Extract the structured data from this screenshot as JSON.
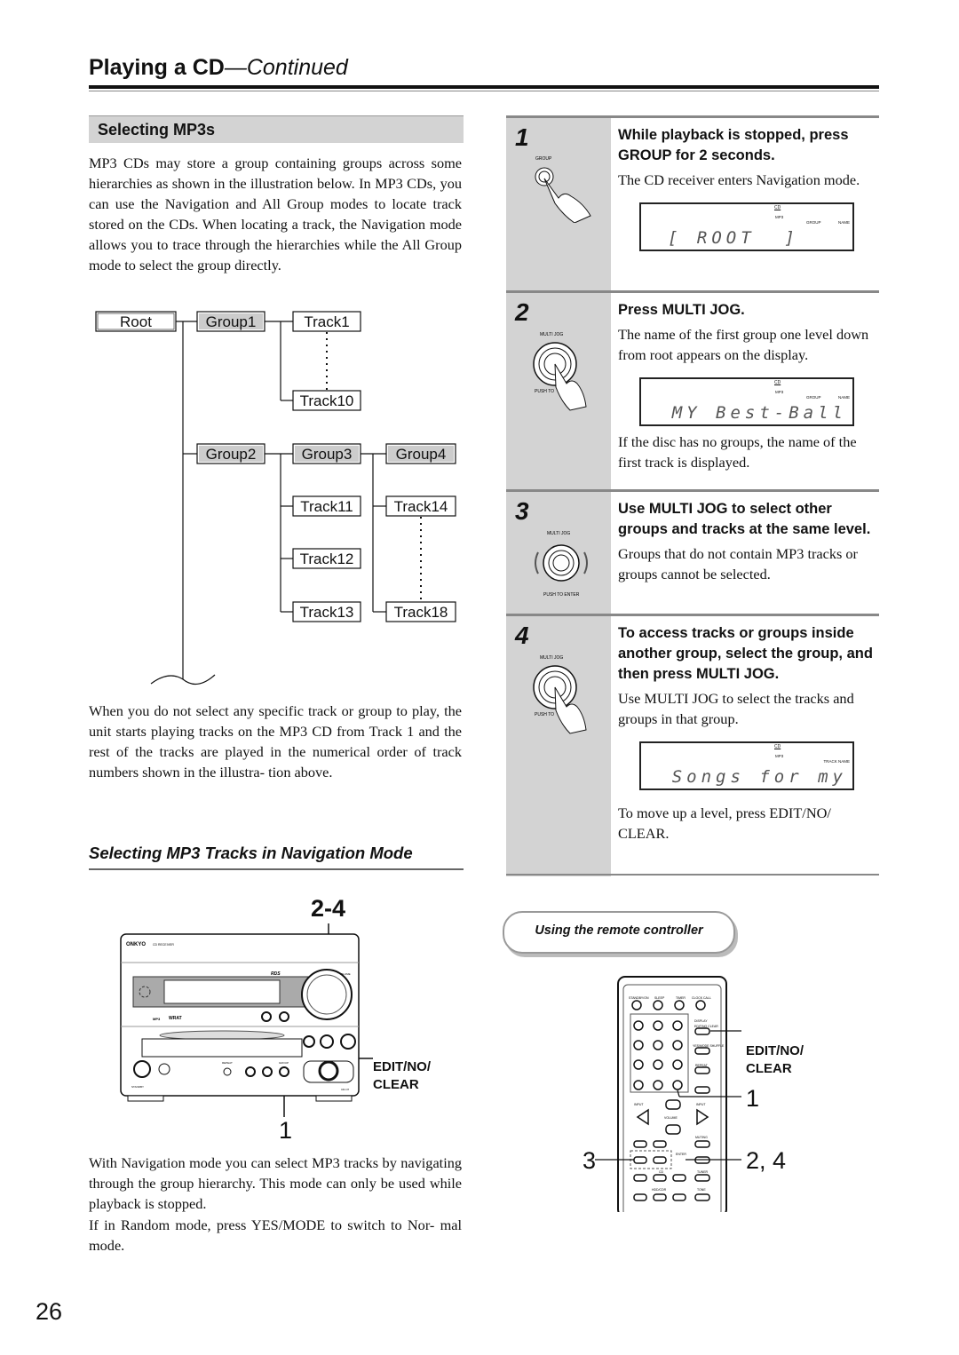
{
  "header": {
    "title": "Playing a CD",
    "title_suffix": "—Continued"
  },
  "section1": {
    "heading": "Selecting MP3s",
    "intro": "MP3 CDs may store a group containing groups across some hierarchies as shown in the illustration below. In MP3 CDs, you can use the Navigation and All Group modes to locate track stored on the CDs. When locating a track, the Navigation mode allows you to trace through the hierarchies while the All Group mode to select the group directly.",
    "tree": {
      "root": "Root",
      "group1": "Group1",
      "group2": "Group2",
      "group3": "Group3",
      "group4": "Group4",
      "track1": "Track1",
      "track10": "Track10",
      "track11": "Track11",
      "track12": "Track12",
      "track13": "Track13",
      "track14": "Track14",
      "track18": "Track18"
    },
    "note": "When you do not select any specific track or group to play, the unit starts playing tracks on the MP3 CD from Track 1 and the rest of the tracks are played in the numerical order of track numbers shown in the illustra- tion above."
  },
  "section2": {
    "heading": "Selecting MP3 Tracks in Navigation Mode",
    "unit_callout_top": "2-4",
    "unit_callout_bottom": "1",
    "unit_callout_right": "EDIT/NO/\nCLEAR",
    "unit_labels": {
      "brand": "ONKYO",
      "model": "CD RECEIVER",
      "rds": "RDS",
      "volume": "VOLUME",
      "mp3": "MP3",
      "wrat": "WRAT",
      "repeat": "REPEAT",
      "group": "GROUP",
      "input": "INPUT",
      "standby": "STANDBY",
      "model_no": "CR-N7"
    },
    "para1": "With Navigation mode you can select MP3 tracks by navigating through the group hierarchy. This mode can only be used while playback is stopped.",
    "para2": "If in Random mode, press YES/MODE to switch to Nor- mal mode."
  },
  "steps": [
    {
      "num": "1",
      "icon_label": "GROUP",
      "head": "While playback is stopped, press GROUP for 2 seconds.",
      "body": "The CD receiver enters Navigation mode.",
      "lcd": {
        "cd": "CD",
        "mp3": "MP3",
        "left": "GROUP",
        "right": "NAME",
        "text": "[ ROOT  ]"
      }
    },
    {
      "num": "2",
      "icon_label": "MULTI JOG",
      "icon_sub": "PUSH TO",
      "head": "Press MULTI JOG.",
      "body": "The name of the first group one level down from root appears on the display.",
      "lcd": {
        "cd": "CD",
        "mp3": "MP3",
        "left": "GROUP",
        "right": "NAME",
        "text": "MY Best-Ball"
      },
      "after": "If the disc has no groups, the name of the first track is displayed."
    },
    {
      "num": "3",
      "icon_label": "MULTI JOG",
      "icon_sub": "PUSH TO ENTER",
      "head": "Use MULTI JOG to select other groups and tracks at the same level.",
      "body": "Groups that do not contain MP3 tracks or groups cannot be selected."
    },
    {
      "num": "4",
      "icon_label": "MULTI JOG",
      "icon_sub": "PUSH TO",
      "head": "To access tracks or groups inside another group, select the group, and then press MULTI JOG.",
      "body": "Use MULTI JOG to select the tracks and groups in that group.",
      "lcd": {
        "cd": "CD",
        "mp3": "MP3",
        "left": "",
        "right": "TRACK NAME",
        "text": "Songs for my"
      },
      "after": "To move up a level, press EDIT/NO/ CLEAR."
    }
  ],
  "remote": {
    "badge": "Using the remote controller",
    "callout_edit": "EDIT/NO/\nCLEAR",
    "callout_1": "1",
    "callout_3": "3",
    "callout_24": "2, 4",
    "labels": {
      "standby": "STANDBY/ON",
      "sleep": "SLEEP",
      "timer": "TIMER",
      "clock": "CLOCK CALL",
      "display": "DISPLAY",
      "edit": "EDIT/NO CLEAR",
      "yes": "YES/MODE SHUFFLE",
      "repeat": "REPEAT",
      "input": "INPUT",
      "volume": "VOLUME",
      "muting": "MUTING",
      "enter": "ENTER",
      "cd": "CD",
      "tuner": "TUNER",
      "hdd": "HDD/CDR",
      "tone": "TONE"
    }
  },
  "footer": {
    "page_number": "26"
  }
}
